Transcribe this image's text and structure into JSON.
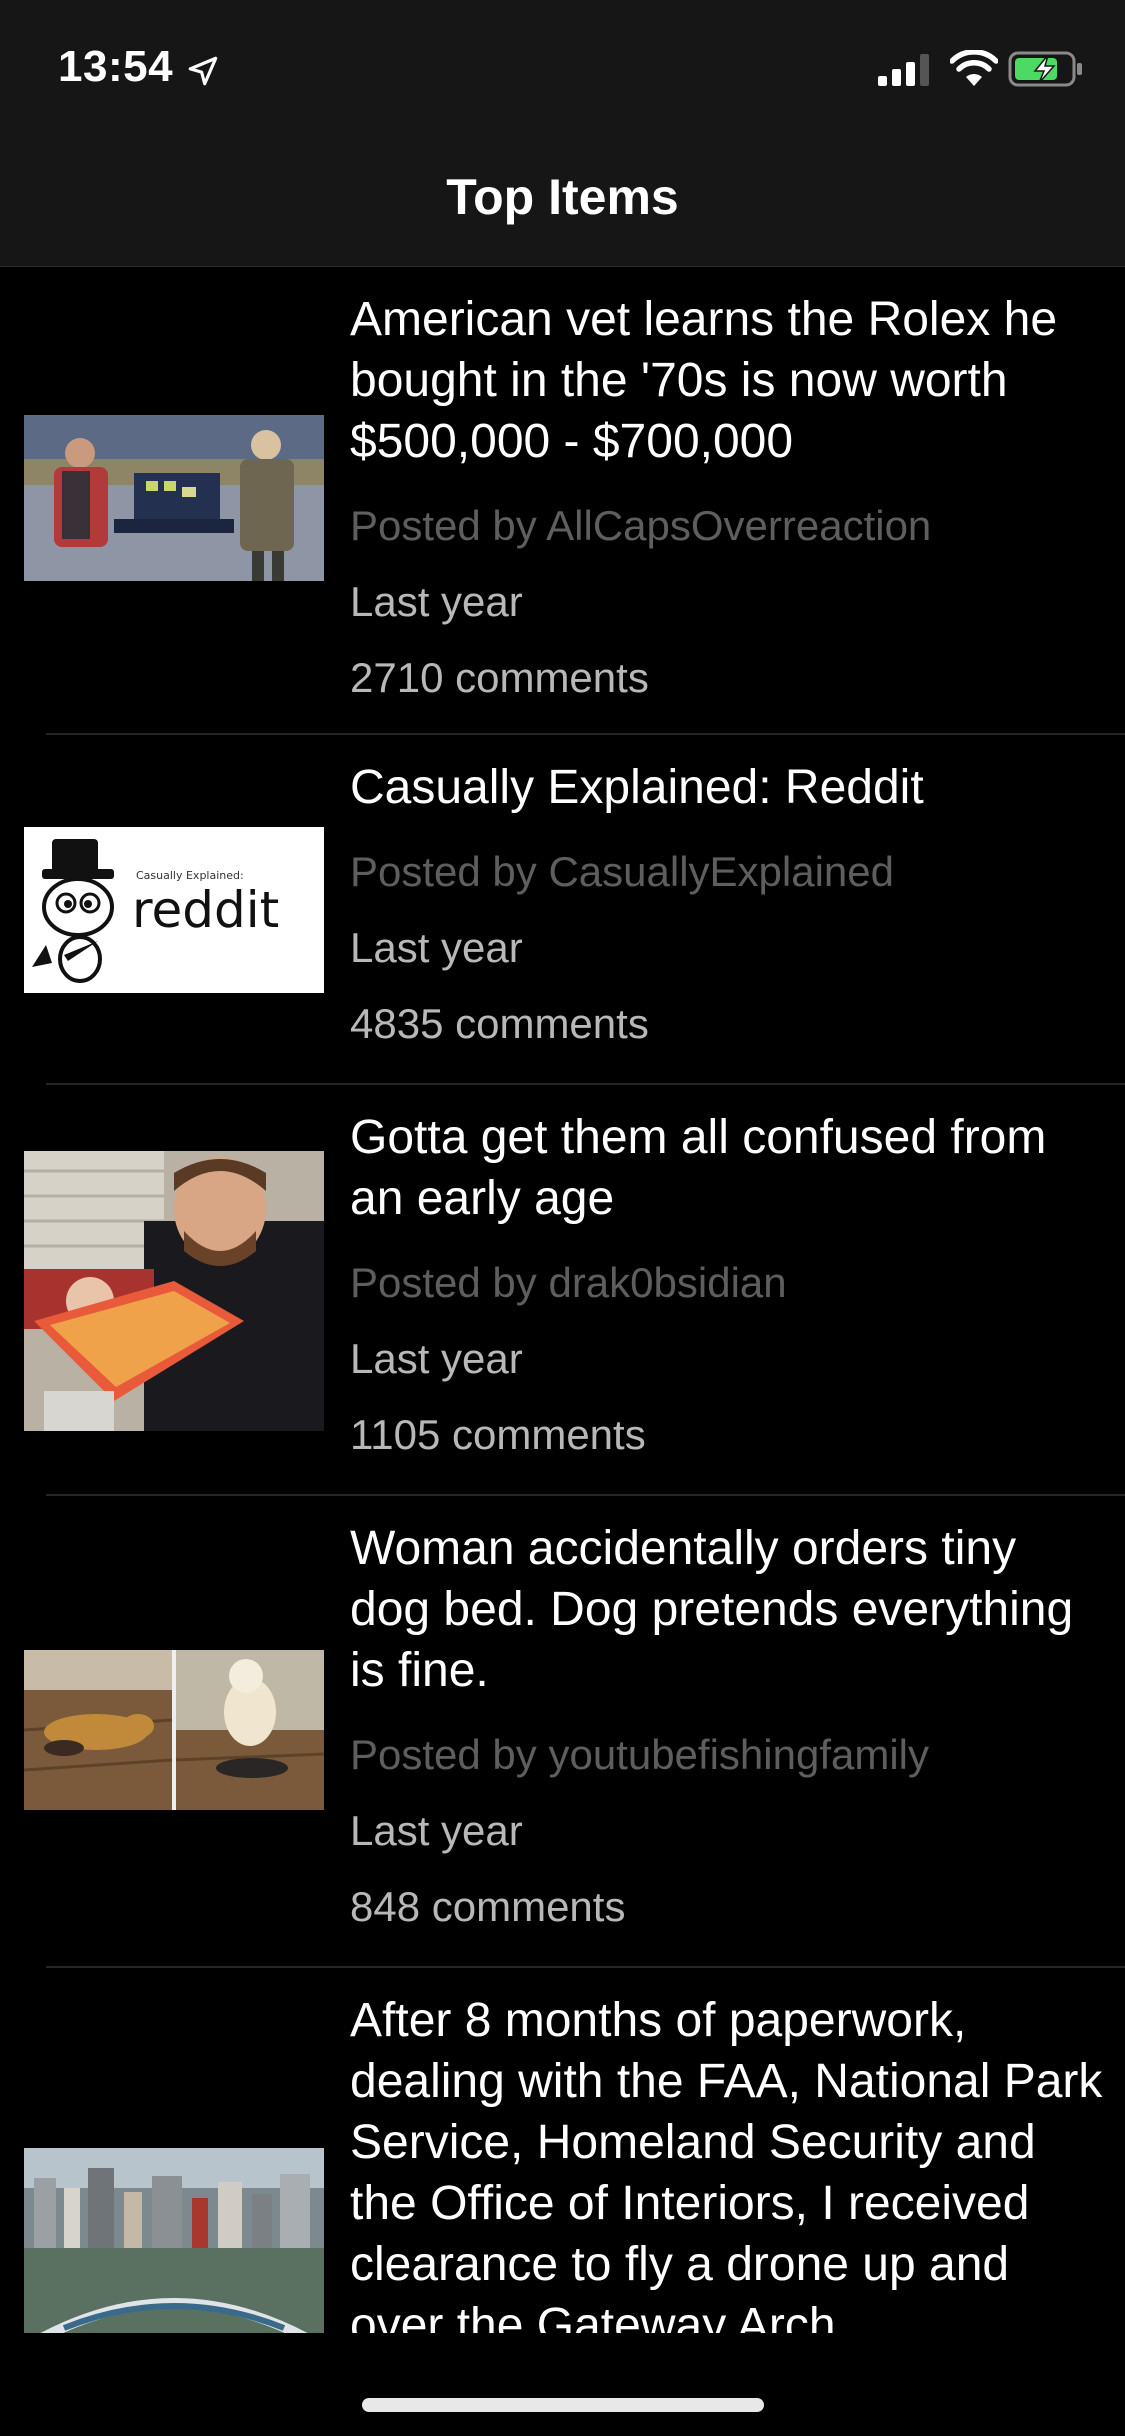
{
  "status_bar": {
    "time": "13:54",
    "icons": [
      "location-arrow-icon",
      "cellular-signal-icon",
      "wifi-icon",
      "battery-charging-icon"
    ]
  },
  "nav": {
    "title": "Top Items"
  },
  "posts": [
    {
      "title": "American vet learns the Rolex he bought in the '70s is now worth $500,000 - $700,000",
      "author": "Posted by AllCapsOverreaction",
      "time": "Last year",
      "comments": "2710 comments"
    },
    {
      "title": "Casually Explained: Reddit",
      "author": "Posted by CasuallyExplained",
      "time": "Last year",
      "comments": "4835 comments",
      "thumb_text": {
        "small": "Casually Explained:",
        "big": "reddit"
      }
    },
    {
      "title": "Gotta get them all confused from an early age",
      "author": "Posted by drak0bsidian",
      "time": "Last year",
      "comments": "1105 comments"
    },
    {
      "title": "Woman accidentally orders tiny dog bed. Dog pretends everything is fine.",
      "author": "Posted by youtubefishingfamily",
      "time": "Last year",
      "comments": "848 comments"
    },
    {
      "title": "After 8 months of paperwork, dealing with the FAA, National Park Service, Homeland Security and the Office of Interiors, I received clearance to fly a drone up and over the Gateway Arch",
      "author": "",
      "time": "",
      "comments": ""
    }
  ]
}
